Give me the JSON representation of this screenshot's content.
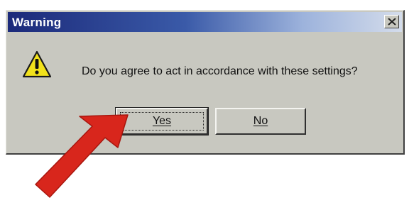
{
  "window": {
    "title": "Warning"
  },
  "dialog": {
    "icon": "warning-triangle-icon",
    "message": "Do you agree to act in accordance with these settings?"
  },
  "buttons": {
    "yes_label": "Yes",
    "no_label": "No"
  },
  "colors": {
    "titlebar_start": "#1c2a7a",
    "titlebar_end": "#d4dceb",
    "dialog_face": "#c8c8c0",
    "warning_yellow": "#f2e21c",
    "pointer_arrow": "#d8261c"
  }
}
